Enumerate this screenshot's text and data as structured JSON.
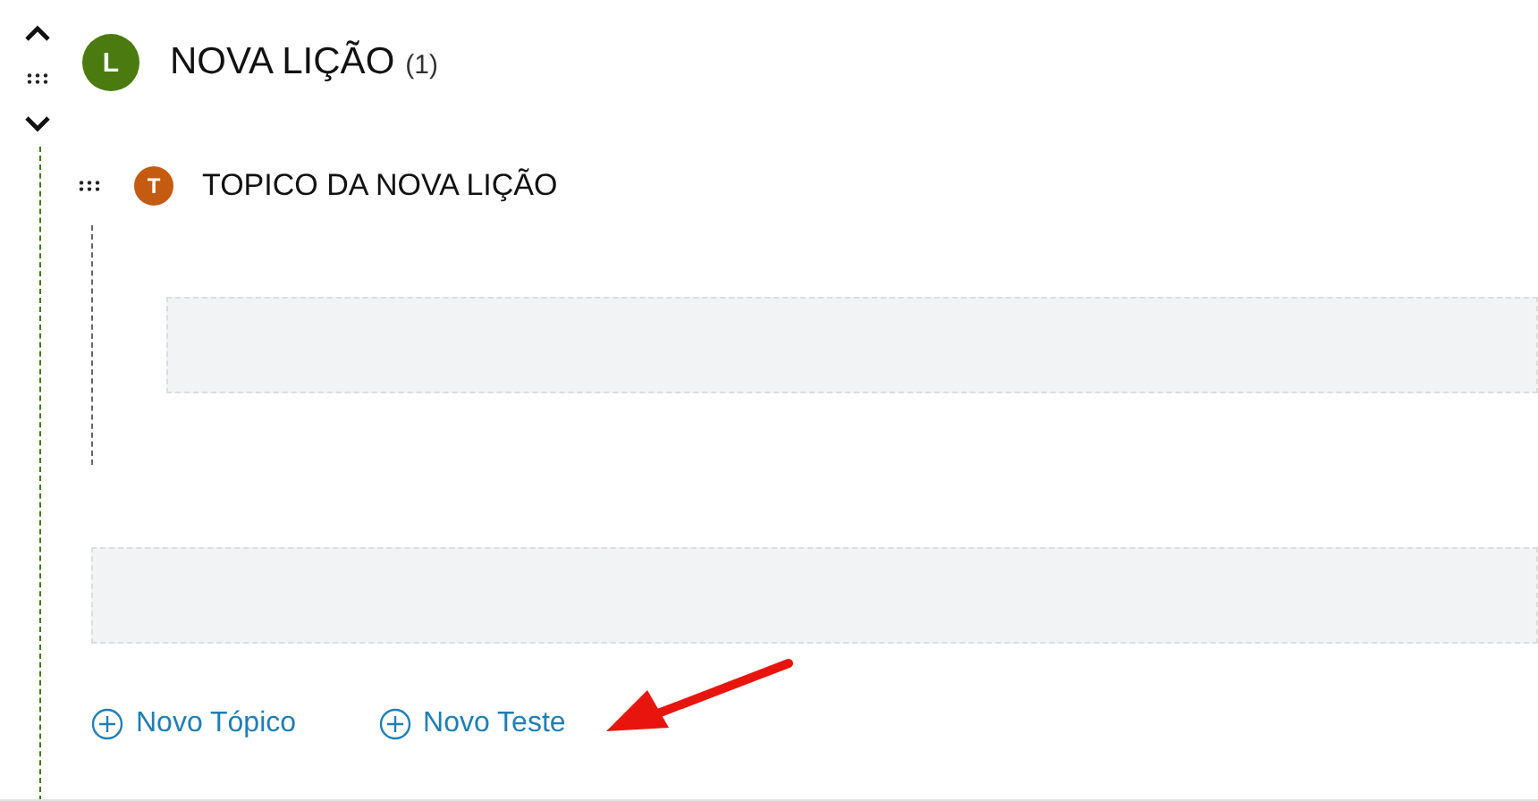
{
  "lesson": {
    "badge": "L",
    "title": "NOVA LIÇÃO",
    "count": "(1)"
  },
  "topic": {
    "badge": "T",
    "title": "TOPICO DA NOVA LIÇÃO"
  },
  "actions": [
    {
      "label": "Novo Tópico"
    },
    {
      "label": "Novo Teste"
    }
  ]
}
